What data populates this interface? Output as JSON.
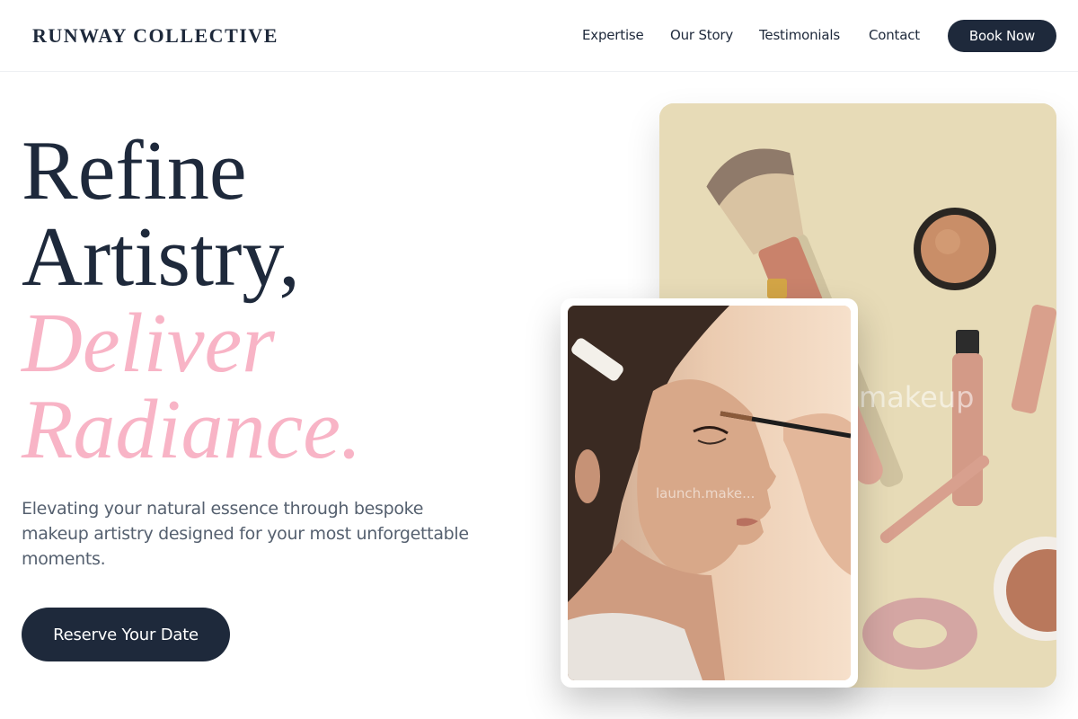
{
  "header": {
    "brand": "RUNWAY COLLECTIVE",
    "nav": [
      "Expertise",
      "Our Story",
      "Testimonials",
      "Contact"
    ],
    "cta": "Book Now"
  },
  "hero": {
    "line1": "Refine",
    "line2": "Artistry,",
    "line3": "Deliver",
    "line4": "Radiance.",
    "subtitle": "Elevating your natural essence through bespoke makeup artistry designed for your most unforgettable moments.",
    "cta": "Reserve Your Date"
  },
  "images": {
    "back_watermark": "makeup",
    "front_watermark": "launch.make..."
  },
  "colors": {
    "primary": "#1e293b",
    "accent_pink": "#f8b4c6",
    "beige": "#e7dbb7"
  }
}
